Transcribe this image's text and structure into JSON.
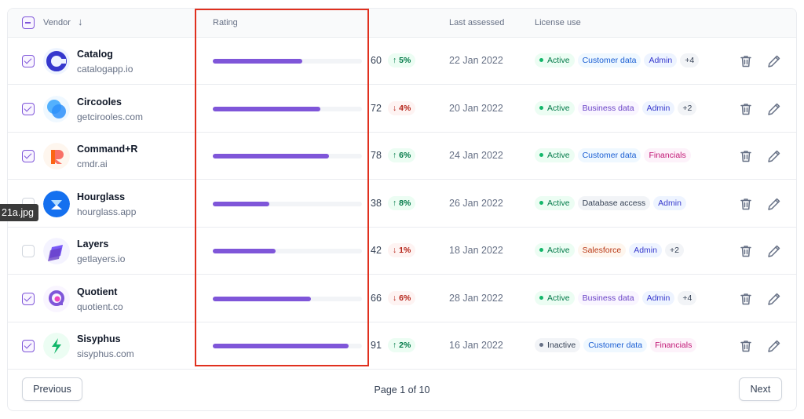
{
  "header": {
    "vendor": "Vendor",
    "rating": "Rating",
    "last_assessed": "Last assessed",
    "license_use": "License use"
  },
  "rows": [
    {
      "checked": true,
      "name": "Catalog",
      "domain": "catalogapp.io",
      "rating": 60,
      "delta": "5%",
      "trend": "up",
      "date": "22 Jan 2022",
      "tags": [
        {
          "label": "Active",
          "style": "active"
        },
        {
          "label": "Customer data",
          "style": "blue"
        },
        {
          "label": "Admin",
          "style": "indigo"
        },
        {
          "label": "+4",
          "style": "gray"
        }
      ]
    },
    {
      "checked": true,
      "name": "Circooles",
      "domain": "getcirooles.com",
      "rating": 72,
      "delta": "4%",
      "trend": "down",
      "date": "20 Jan 2022",
      "tags": [
        {
          "label": "Active",
          "style": "active"
        },
        {
          "label": "Business data",
          "style": "purple"
        },
        {
          "label": "Admin",
          "style": "indigo"
        },
        {
          "label": "+2",
          "style": "gray"
        }
      ]
    },
    {
      "checked": true,
      "name": "Command+R",
      "domain": "cmdr.ai",
      "rating": 78,
      "delta": "6%",
      "trend": "up",
      "date": "24 Jan 2022",
      "tags": [
        {
          "label": "Active",
          "style": "active"
        },
        {
          "label": "Customer data",
          "style": "blue"
        },
        {
          "label": "Financials",
          "style": "pink"
        }
      ]
    },
    {
      "checked": false,
      "name": "Hourglass",
      "domain": "hourglass.app",
      "rating": 38,
      "delta": "8%",
      "trend": "up",
      "date": "26 Jan 2022",
      "tags": [
        {
          "label": "Active",
          "style": "active"
        },
        {
          "label": "Database access",
          "style": "gray"
        },
        {
          "label": "Admin",
          "style": "indigo"
        }
      ]
    },
    {
      "checked": false,
      "name": "Layers",
      "domain": "getlayers.io",
      "rating": 42,
      "delta": "1%",
      "trend": "down",
      "date": "18 Jan 2022",
      "tags": [
        {
          "label": "Active",
          "style": "active"
        },
        {
          "label": "Salesforce",
          "style": "orange"
        },
        {
          "label": "Admin",
          "style": "indigo"
        },
        {
          "label": "+2",
          "style": "gray"
        }
      ]
    },
    {
      "checked": true,
      "name": "Quotient",
      "domain": "quotient.co",
      "rating": 66,
      "delta": "6%",
      "trend": "down",
      "date": "28 Jan 2022",
      "tags": [
        {
          "label": "Active",
          "style": "active"
        },
        {
          "label": "Business data",
          "style": "purple"
        },
        {
          "label": "Admin",
          "style": "indigo"
        },
        {
          "label": "+4",
          "style": "gray"
        }
      ]
    },
    {
      "checked": true,
      "name": "Sisyphus",
      "domain": "sisyphus.com",
      "rating": 91,
      "delta": "2%",
      "trend": "up",
      "date": "16 Jan 2022",
      "tags": [
        {
          "label": "Inactive",
          "style": "inactive"
        },
        {
          "label": "Customer data",
          "style": "blue"
        },
        {
          "label": "Financials",
          "style": "pink"
        }
      ]
    }
  ],
  "footer": {
    "previous": "Previous",
    "page_info": "Page 1 of 10",
    "next": "Next"
  },
  "overlay": {
    "file_tag": "21a.jpg"
  },
  "colors": {
    "accent": "#7f56d9",
    "highlight": "#e0301e"
  }
}
